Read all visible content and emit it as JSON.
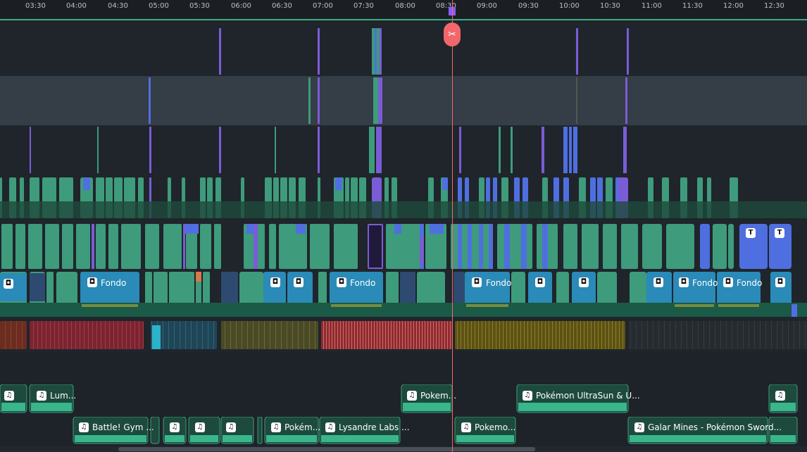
{
  "ruler": {
    "ticks": [
      "03:30",
      "04:00",
      "04:30",
      "05:00",
      "05:30",
      "06:00",
      "06:30",
      "07:00",
      "07:30",
      "08:00",
      "08:30",
      "09:00",
      "09:30",
      "10:00",
      "10:30",
      "11:00",
      "11:30",
      "12:00",
      "12:30"
    ]
  },
  "video_clips": {
    "fondo": "Fondo"
  },
  "title_clips": {
    "title_badge": "T"
  },
  "audio_track_1": {
    "clip_1": "Lum...",
    "clip_2": "Pokem...",
    "clip_3": "Pokémon UltraSun & U..."
  },
  "audio_track_2": {
    "clip_1": "Battle! Gym ...",
    "clip_2": "Pokém...",
    "clip_3": "Lysandre Labs ...",
    "clip_4": "Pokemo...",
    "clip_5": "Galar Mines - Pokémon Sword..."
  },
  "colors": {
    "green": "#3e9b7b",
    "purple": "#7a5cd6",
    "blue": "#4f6fe0",
    "playhead": "#f2676b"
  }
}
